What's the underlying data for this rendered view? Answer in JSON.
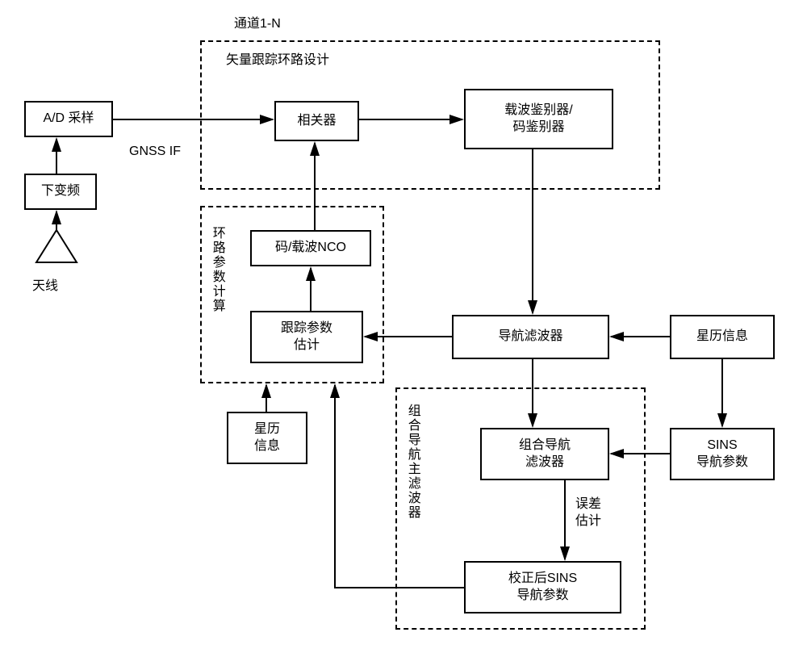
{
  "title": "通道1-N",
  "regions": {
    "vector_loop": "矢量跟踪环路设计",
    "loop_param": "环路参数计算",
    "main_filter": "组合导航主滤波器"
  },
  "blocks": {
    "antenna": "天线",
    "downconv": "下变频",
    "ad": "A/D 采样",
    "gnss_if": "GNSS IF",
    "correlator": "相关器",
    "discriminator": "载波鉴别器/\n码鉴别器",
    "nco": "码/载波NCO",
    "track_est": "跟踪参数\n估计",
    "nav_filter": "导航滤波器",
    "ephemeris1": "星历\n信息",
    "ephemeris2": "星历信息",
    "int_nav_filter": "组合导航\n滤波器",
    "sins_params": "SINS\n导航参数",
    "err_est": "误差\n估计",
    "corr_sins": "校正后SINS\n导航参数"
  }
}
